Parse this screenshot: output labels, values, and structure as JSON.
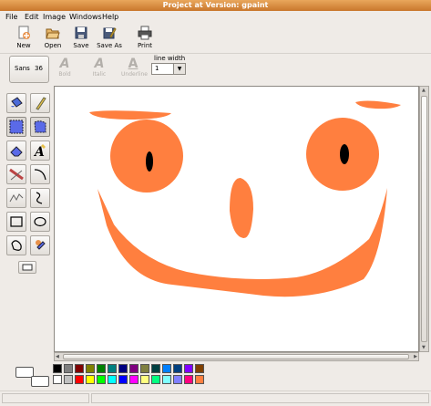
{
  "window": {
    "title": "Project at Version: gpaint"
  },
  "menu": [
    "File",
    "Edit",
    "Image",
    "Windows",
    "Help"
  ],
  "toolbar": {
    "new_label": "New",
    "open_label": "Open",
    "save_label": "Save",
    "saveas_label": "Save As",
    "print_label": "Print"
  },
  "textbar": {
    "font_name": "Sans",
    "font_size": "36",
    "bold_label": "Bold",
    "italic_label": "Italic",
    "underline_label": "Underline",
    "line_width_label": "line width",
    "line_width_value": "1"
  },
  "tools": [
    "paint-bucket",
    "lasso",
    "rect-select",
    "freehand-select",
    "eraser",
    "text",
    "line",
    "curve",
    "brush",
    "pen",
    "rectangle",
    "oval",
    "freehand-shape",
    "color-picker"
  ],
  "colors": {
    "face": "#ff7f3f",
    "accent": "#e8914a"
  },
  "palette": {
    "row1": [
      "#000000",
      "#808080",
      "#800000",
      "#808000",
      "#008000",
      "#008080",
      "#000080",
      "#800080",
      "#808040",
      "#004040",
      "#0080ff",
      "#004080",
      "#8000ff",
      "#804000"
    ],
    "row2": [
      "#ffffff",
      "#c0c0c0",
      "#ff0000",
      "#ffff00",
      "#00ff00",
      "#00ffff",
      "#0000ff",
      "#ff00ff",
      "#ffff80",
      "#00ff80",
      "#80ffff",
      "#8080ff",
      "#ff0080",
      "#ff8040"
    ]
  }
}
